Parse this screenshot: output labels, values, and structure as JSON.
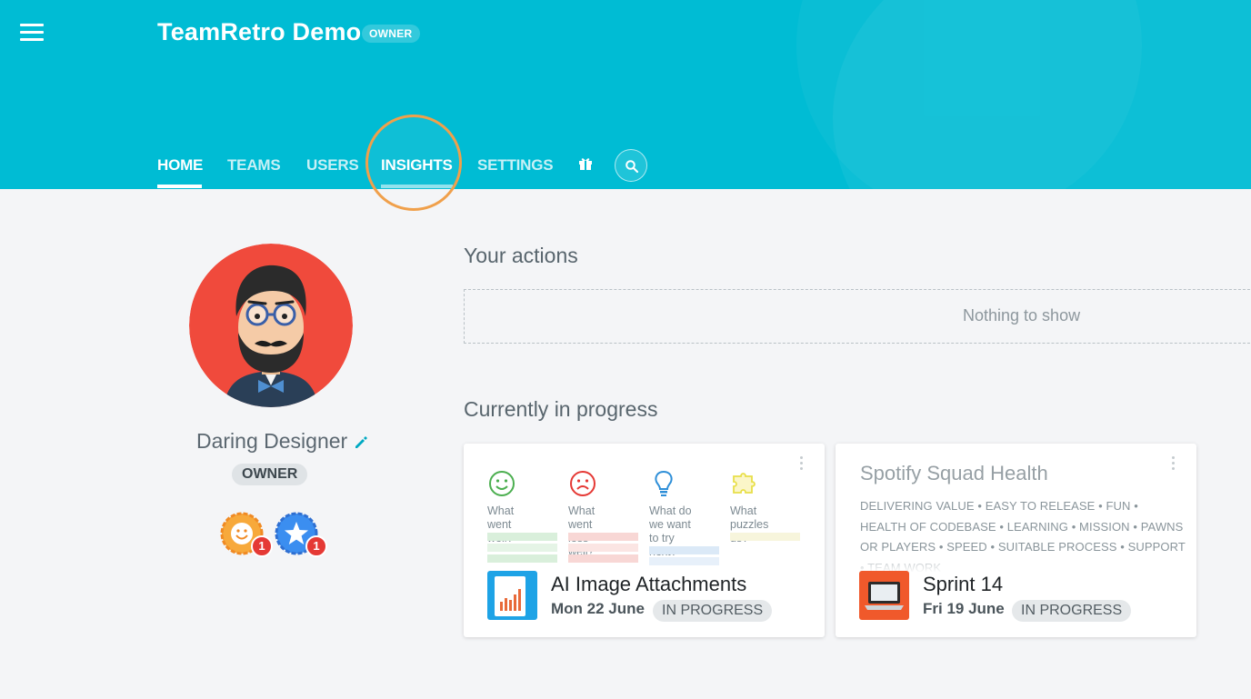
{
  "header": {
    "app_title": "TeamRetro Demo",
    "role_badge": "OWNER",
    "brand_color": "#00bcd4"
  },
  "nav": {
    "items": [
      {
        "label": "HOME",
        "active": true
      },
      {
        "label": "TEAMS",
        "active": false
      },
      {
        "label": "USERS",
        "active": false
      },
      {
        "label": "INSIGHTS",
        "active": false
      },
      {
        "label": "SETTINGS",
        "active": false
      }
    ],
    "icons": [
      "menu-icon",
      "gift-icon",
      "search-icon"
    ],
    "highlight_color": "#f0a04b"
  },
  "profile": {
    "name": "Daring Designer",
    "role": "OWNER",
    "badges": [
      {
        "icon": "smiley-badge-icon",
        "count": "1",
        "color": "#f08a24"
      },
      {
        "icon": "star-badge-icon",
        "count": "1",
        "color": "#2f80ed"
      }
    ]
  },
  "actions": {
    "title": "Your actions",
    "empty_text": "Nothing to show"
  },
  "in_progress": {
    "title": "Currently in progress",
    "cards": [
      {
        "columns": [
          {
            "label": "What went well?",
            "icon": "happy-face-icon",
            "color": "#4caf50"
          },
          {
            "label": "What went less well?",
            "icon": "sad-face-icon",
            "color": "#e53935"
          },
          {
            "label": "What do we want to try next?",
            "icon": "lightbulb-icon",
            "color": "#2f8fd8"
          },
          {
            "label": "What puzzles us?",
            "icon": "puzzle-icon",
            "color": "#e8df4a"
          }
        ],
        "title": "AI Image Attachments",
        "date": "Mon 22 June",
        "status": "IN PROGRESS"
      },
      {
        "heading": "Spotify Squad Health",
        "tags": "DELIVERING VALUE • EASY TO RELEASE • FUN • HEALTH OF CODEBASE • LEARNING • MISSION • PAWNS OR PLAYERS • SPEED • SUITABLE PROCESS • SUPPORT • TEAM WORK",
        "title": "Sprint 14",
        "date": "Fri 19 June",
        "status": "IN PROGRESS"
      }
    ]
  }
}
